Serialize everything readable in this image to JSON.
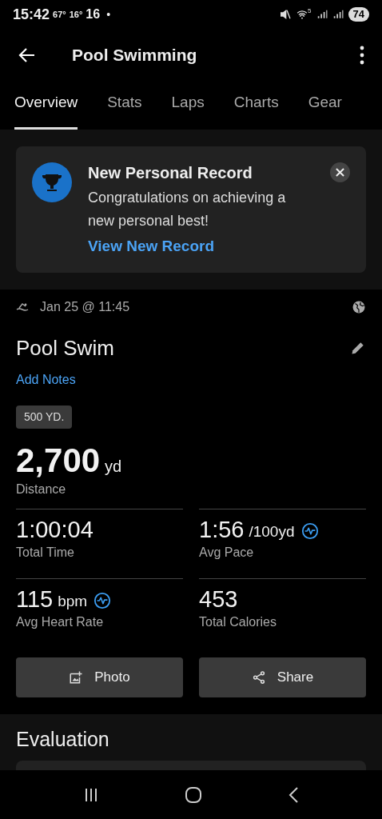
{
  "status_bar": {
    "time": "15:42",
    "temps": [
      "67°",
      "16°",
      "16"
    ],
    "dot": "•",
    "wifi_band": "5",
    "battery": "74"
  },
  "app_bar": {
    "title": "Pool Swimming"
  },
  "tabs": [
    {
      "label": "Overview",
      "selected": true
    },
    {
      "label": "Stats",
      "selected": false
    },
    {
      "label": "Laps",
      "selected": false
    },
    {
      "label": "Charts",
      "selected": false
    },
    {
      "label": "Gear",
      "selected": false
    }
  ],
  "record_card": {
    "title": "New Personal Record",
    "message": "Congratulations on achieving a new personal best!",
    "link": "View New Record"
  },
  "activity": {
    "date": "Jan 25 @ 11:45",
    "name": "Pool Swim",
    "notes_link": "Add Notes",
    "badge": "500 YD.",
    "distance": {
      "value": "2,700",
      "unit": "yd",
      "label": "Distance"
    }
  },
  "stats": [
    {
      "value": "1:00:04",
      "label": "Total Time",
      "chart_icon": false
    },
    {
      "value": "1:56",
      "unit": "/100yd",
      "label": "Avg Pace",
      "chart_icon": true
    },
    {
      "value": "115",
      "unit": "bpm",
      "label": "Avg Heart Rate",
      "chart_icon": true
    },
    {
      "value": "453",
      "label": "Total Calories",
      "chart_icon": false
    }
  ],
  "actions": [
    {
      "kind": "photo",
      "label": "Photo"
    },
    {
      "kind": "share",
      "label": "Share"
    }
  ],
  "evaluation": {
    "title": "Evaluation"
  }
}
